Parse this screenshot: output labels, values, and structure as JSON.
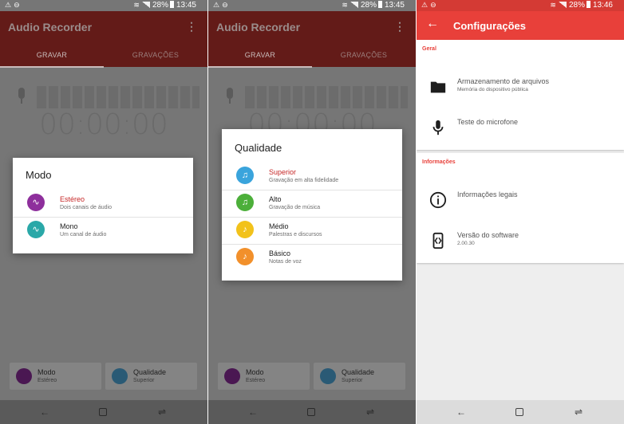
{
  "colors": {
    "accent_red": "#e8403a",
    "selected_text": "#c62828",
    "stereo_purple": "#8e2f9c",
    "mono_teal": "#2aa8a8",
    "superior_blue": "#3aa4dc",
    "alto_green": "#4caf3a",
    "medio_yellow": "#f2c21b",
    "basico_orange": "#f2902b"
  },
  "status": {
    "icons": [
      "warning-icon",
      "minus-circle-icon",
      "wifi-icon",
      "signal-icon",
      "battery-icon"
    ],
    "battery": "28%",
    "time_1": "13:45",
    "time_2": "13:45",
    "time_3": "13:46"
  },
  "recorder": {
    "app_title": "Audio Recorder",
    "tab_record": "GRAVAR",
    "tab_recordings": "GRAVAÇÕES",
    "timer": "00:00:00",
    "mode_card": {
      "label": "Modo",
      "value": "Estéreo"
    },
    "quality_card": {
      "label": "Qualidade",
      "value": "Superior"
    }
  },
  "mode_dialog": {
    "title": "Modo",
    "options": [
      {
        "label": "Estéreo",
        "subtitle": "Dois canais de áudio",
        "selected": true,
        "icon": "waveform-icon"
      },
      {
        "label": "Mono",
        "subtitle": "Um canal de áudio",
        "selected": false,
        "icon": "waveform-icon"
      }
    ]
  },
  "quality_dialog": {
    "title": "Qualidade",
    "options": [
      {
        "label": "Superior",
        "subtitle": "Gravação em alta fidelidade",
        "selected": true,
        "icon": "music-note-icon"
      },
      {
        "label": "Alto",
        "subtitle": "Gravação de música",
        "selected": false,
        "icon": "music-note-icon"
      },
      {
        "label": "Médio",
        "subtitle": "Palestras e discursos",
        "selected": false,
        "icon": "music-note-icon"
      },
      {
        "label": "Básico",
        "subtitle": "Notas de voz",
        "selected": false,
        "icon": "music-note-icon"
      }
    ]
  },
  "settings": {
    "title": "Configurações",
    "general_header": "Geral",
    "storage": {
      "title": "Armazenamento de arquivos",
      "subtitle": "Memória do dispositivo pública"
    },
    "mic_test": {
      "title": "Teste do microfone"
    },
    "info_header": "Informações",
    "legal": {
      "title": "Informações legais"
    },
    "version": {
      "title": "Versão do software",
      "subtitle": "2.00.30"
    }
  },
  "nav": {
    "icons": [
      "back-icon",
      "home-icon",
      "recents-icon"
    ]
  }
}
